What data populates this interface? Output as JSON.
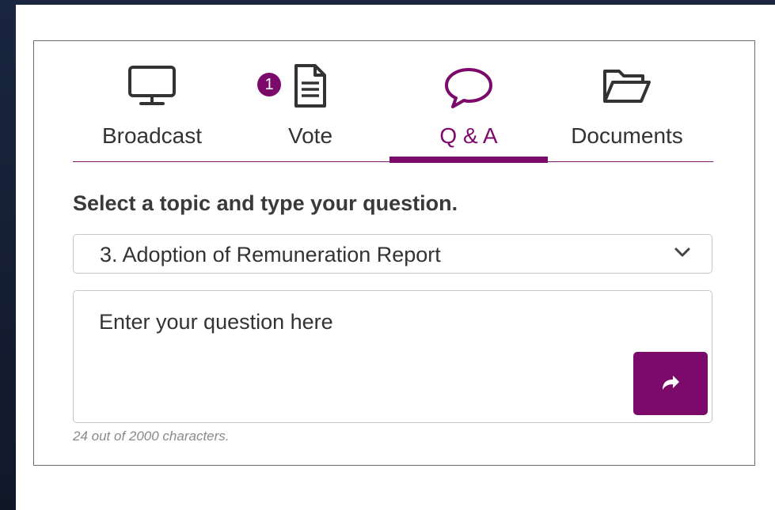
{
  "tabs": [
    {
      "label": "Broadcast",
      "icon": "monitor-icon",
      "active": false
    },
    {
      "label": "Vote",
      "icon": "document-icon",
      "active": false,
      "badge": "1"
    },
    {
      "label": "Q & A",
      "icon": "speech-bubble-icon",
      "active": true
    },
    {
      "label": "Documents",
      "icon": "folder-open-icon",
      "active": false
    }
  ],
  "qa": {
    "prompt": "Select a topic and type your question.",
    "topic_selected": "3. Adoption of Remuneration Report",
    "question_placeholder": "Enter your question here",
    "char_counter": "24 out of 2000  characters."
  },
  "colors": {
    "accent": "#7b0a6b",
    "text": "#333333",
    "border": "#c8c8c8"
  }
}
